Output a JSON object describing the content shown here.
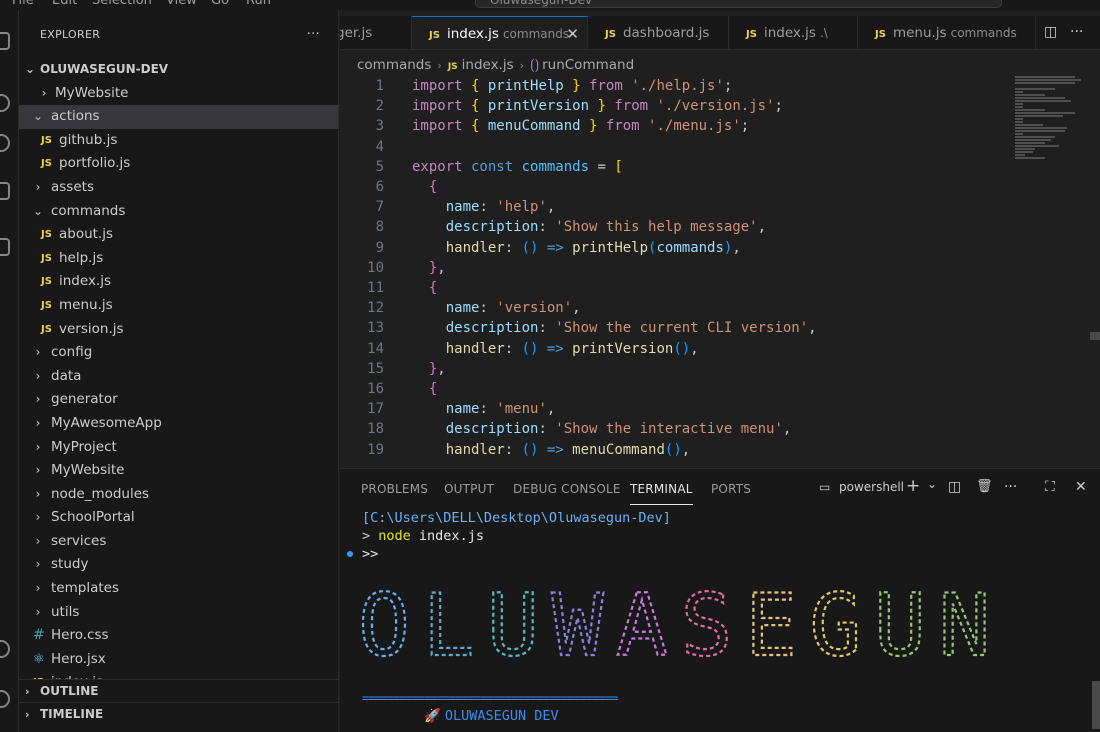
{
  "menubar": {
    "items": [
      "File",
      "Edit",
      "Selection",
      "View",
      "Go",
      "Run"
    ],
    "search_text": "Oluwasegun-Dev"
  },
  "sidebar": {
    "title": "EXPLORER",
    "more": "···",
    "root": "OLUWASEGUN-DEV",
    "items": [
      {
        "label": "MyWebsite",
        "kind": "folder",
        "expanded": false
      },
      {
        "label": "actions",
        "kind": "folder",
        "expanded": true,
        "selected": true
      },
      {
        "label": "github.js",
        "kind": "js"
      },
      {
        "label": "portfolio.js",
        "kind": "js"
      },
      {
        "label": "assets",
        "kind": "folder",
        "expanded": false
      },
      {
        "label": "commands",
        "kind": "folder",
        "expanded": true
      },
      {
        "label": "about.js",
        "kind": "js"
      },
      {
        "label": "help.js",
        "kind": "js"
      },
      {
        "label": "index.js",
        "kind": "js"
      },
      {
        "label": "menu.js",
        "kind": "js"
      },
      {
        "label": "version.js",
        "kind": "js"
      },
      {
        "label": "config",
        "kind": "folder",
        "expanded": false
      },
      {
        "label": "data",
        "kind": "folder",
        "expanded": false
      },
      {
        "label": "generator",
        "kind": "folder",
        "expanded": false
      },
      {
        "label": "MyAwesomeApp",
        "kind": "folder",
        "expanded": false
      },
      {
        "label": "MyProject",
        "kind": "folder",
        "expanded": false
      },
      {
        "label": "MyWebsite",
        "kind": "folder",
        "expanded": false
      },
      {
        "label": "node_modules",
        "kind": "folder",
        "expanded": false
      },
      {
        "label": "SchoolPortal",
        "kind": "folder",
        "expanded": false
      },
      {
        "label": "services",
        "kind": "folder",
        "expanded": false
      },
      {
        "label": "study",
        "kind": "folder",
        "expanded": false
      },
      {
        "label": "templates",
        "kind": "folder",
        "expanded": false
      },
      {
        "label": "utils",
        "kind": "folder",
        "expanded": false
      },
      {
        "label": "Hero.css",
        "kind": "css"
      },
      {
        "label": "Hero.jsx",
        "kind": "react"
      },
      {
        "label": "index.js",
        "kind": "js"
      }
    ],
    "outline": "OUTLINE",
    "timeline": "TIMELINE"
  },
  "tabs": [
    {
      "name": "ger.js",
      "desc": "",
      "icon": "none",
      "active": false
    },
    {
      "name": "index.js",
      "desc": "commands",
      "icon": "js",
      "active": true
    },
    {
      "name": "dashboard.js",
      "desc": "",
      "icon": "js",
      "active": false
    },
    {
      "name": "index.js",
      "desc": ".\\",
      "icon": "js",
      "active": false
    },
    {
      "name": "menu.js",
      "desc": "commands",
      "icon": "js",
      "active": false
    }
  ],
  "tab_close": "✕",
  "breadcrumb": {
    "folder": "commands",
    "file": "index.js",
    "symbol": "runCommand"
  },
  "editor": {
    "lines": [
      {
        "n": "1",
        "tokens": [
          [
            "kw",
            "import"
          ],
          [
            "punc",
            " "
          ],
          [
            "br1",
            "{"
          ],
          [
            "var",
            " printHelp "
          ],
          [
            "br1",
            "}"
          ],
          [
            "kw",
            " from"
          ],
          [
            "str",
            " './help.js'"
          ],
          [
            "punc",
            ";"
          ]
        ]
      },
      {
        "n": "2",
        "tokens": [
          [
            "kw",
            "import"
          ],
          [
            "punc",
            " "
          ],
          [
            "br1",
            "{"
          ],
          [
            "var",
            " printVersion "
          ],
          [
            "br1",
            "}"
          ],
          [
            "kw",
            " from"
          ],
          [
            "str",
            " './version.js'"
          ],
          [
            "punc",
            ";"
          ]
        ]
      },
      {
        "n": "3",
        "tokens": [
          [
            "kw",
            "import"
          ],
          [
            "punc",
            " "
          ],
          [
            "br1",
            "{"
          ],
          [
            "var",
            " menuCommand "
          ],
          [
            "br1",
            "}"
          ],
          [
            "kw",
            " from"
          ],
          [
            "str",
            " './menu.js'"
          ],
          [
            "punc",
            ";"
          ]
        ]
      },
      {
        "n": "4",
        "tokens": []
      },
      {
        "n": "5",
        "tokens": [
          [
            "kw",
            "export"
          ],
          [
            "kw2",
            " const"
          ],
          [
            "cst",
            " commands"
          ],
          [
            "punc",
            " = "
          ],
          [
            "br1",
            "["
          ]
        ]
      },
      {
        "n": "6",
        "tokens": [
          [
            "punc",
            "  "
          ],
          [
            "br2",
            "{"
          ]
        ]
      },
      {
        "n": "7",
        "tokens": [
          [
            "punc",
            "    "
          ],
          [
            "prop",
            "name"
          ],
          [
            "punc",
            ": "
          ],
          [
            "str",
            "'help'"
          ],
          [
            "punc",
            ","
          ]
        ]
      },
      {
        "n": "8",
        "tokens": [
          [
            "punc",
            "    "
          ],
          [
            "prop",
            "description"
          ],
          [
            "punc",
            ": "
          ],
          [
            "str",
            "'Show this help message'"
          ],
          [
            "punc",
            ","
          ]
        ]
      },
      {
        "n": "9",
        "tokens": [
          [
            "punc",
            "    "
          ],
          [
            "fn",
            "handler"
          ],
          [
            "punc",
            ": "
          ],
          [
            "br3",
            "()"
          ],
          [
            "kw2",
            " =>"
          ],
          [
            "fn",
            " printHelp"
          ],
          [
            "br3",
            "("
          ],
          [
            "var",
            "commands"
          ],
          [
            "br3",
            ")"
          ],
          [
            "punc",
            ","
          ]
        ]
      },
      {
        "n": "10",
        "tokens": [
          [
            "punc",
            "  "
          ],
          [
            "br2",
            "}"
          ],
          [
            "punc",
            ","
          ]
        ]
      },
      {
        "n": "11",
        "tokens": [
          [
            "punc",
            "  "
          ],
          [
            "br2",
            "{"
          ]
        ]
      },
      {
        "n": "12",
        "tokens": [
          [
            "punc",
            "    "
          ],
          [
            "prop",
            "name"
          ],
          [
            "punc",
            ": "
          ],
          [
            "str",
            "'version'"
          ],
          [
            "punc",
            ","
          ]
        ]
      },
      {
        "n": "13",
        "tokens": [
          [
            "punc",
            "    "
          ],
          [
            "prop",
            "description"
          ],
          [
            "punc",
            ": "
          ],
          [
            "str",
            "'Show the current CLI version'"
          ],
          [
            "punc",
            ","
          ]
        ]
      },
      {
        "n": "14",
        "tokens": [
          [
            "punc",
            "    "
          ],
          [
            "fn",
            "handler"
          ],
          [
            "punc",
            ": "
          ],
          [
            "br3",
            "()"
          ],
          [
            "kw2",
            " =>"
          ],
          [
            "fn",
            " printVersion"
          ],
          [
            "br3",
            "()"
          ],
          [
            "punc",
            ","
          ]
        ]
      },
      {
        "n": "15",
        "tokens": [
          [
            "punc",
            "  "
          ],
          [
            "br2",
            "}"
          ],
          [
            "punc",
            ","
          ]
        ]
      },
      {
        "n": "16",
        "tokens": [
          [
            "punc",
            "  "
          ],
          [
            "br2",
            "{"
          ]
        ]
      },
      {
        "n": "17",
        "tokens": [
          [
            "punc",
            "    "
          ],
          [
            "prop",
            "name"
          ],
          [
            "punc",
            ": "
          ],
          [
            "str",
            "'menu'"
          ],
          [
            "punc",
            ","
          ]
        ]
      },
      {
        "n": "18",
        "tokens": [
          [
            "punc",
            "    "
          ],
          [
            "prop",
            "description"
          ],
          [
            "punc",
            ": "
          ],
          [
            "str",
            "'Show the interactive menu'"
          ],
          [
            "punc",
            ","
          ]
        ]
      },
      {
        "n": "19",
        "tokens": [
          [
            "punc",
            "    "
          ],
          [
            "fn",
            "handler"
          ],
          [
            "punc",
            ": "
          ],
          [
            "br3",
            "()"
          ],
          [
            "kw2",
            " =>"
          ],
          [
            "fn",
            " menuCommand"
          ],
          [
            "br3",
            "()"
          ],
          [
            "punc",
            ","
          ]
        ]
      }
    ],
    "token_colors": {
      "kw": "#c586c0",
      "kw2": "#569cd6",
      "str": "#ce9178",
      "fn": "#dcdcaa",
      "var": "#9cdcfe",
      "cst": "#4fc1ff",
      "br1": "#ffd700",
      "br2": "#da70d6",
      "br3": "#179fff",
      "prop": "#9cdcfe",
      "punc": "#cccccc"
    }
  },
  "panel": {
    "tabs": [
      "PROBLEMS",
      "OUTPUT",
      "DEBUG CONSOLE",
      "TERMINAL",
      "PORTS"
    ],
    "active_tab": "TERMINAL",
    "shell_name": "powershell",
    "actions": {
      "add": "+",
      "dropdown": "⌄",
      "split": "◫",
      "trash": "🗑",
      "more": "···",
      "maximize": "⛶",
      "close": "✕"
    }
  },
  "terminal": {
    "path": "[C:\\Users\\DELL\\Desktop\\Oluwasegun-Dev]",
    "prompt_arrow": ">",
    "command": "node",
    "command_args": " index.js",
    "prompt2": ">>",
    "banner": "OLUWASEGUN",
    "banner_colors": [
      "#61afef",
      "#5ba8d0",
      "#56b6c2",
      "#8a7fe0",
      "#c678dd",
      "#e06c9a",
      "#e5c07b",
      "#d7c96a",
      "#98c379",
      "#98c379"
    ],
    "rule": "=========================================",
    "title": "OLUWASEGUN DEV",
    "title_icon": "🚀"
  }
}
